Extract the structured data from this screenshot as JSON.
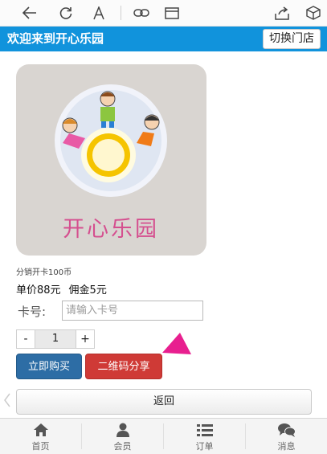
{
  "browser": {
    "back_icon": "arrow-left-icon",
    "refresh_icon": "refresh-icon",
    "font_icon": "font-size-icon",
    "link_icon": "link-icon",
    "window_icon": "window-icon",
    "share_icon": "share-icon",
    "box_icon": "cube-icon"
  },
  "header": {
    "title": "欢迎来到开心乐园",
    "switch_label": "切换门店"
  },
  "product": {
    "image_icon": "happy-park-logo-icon",
    "logo_text": "开心乐园",
    "sales_label": "分销开卡100币",
    "price": "单价88元",
    "commission": "佣金5元"
  },
  "card": {
    "label": "卡号:",
    "placeholder": "请输入卡号",
    "value": ""
  },
  "quantity": {
    "minus": "-",
    "value": "1",
    "plus": "+"
  },
  "actions": {
    "buy_label": "立即购买",
    "share_label": "二维码分享",
    "back_label": "返回"
  },
  "colors": {
    "header": "#1193dc",
    "buy": "#2d6da5",
    "share": "#cf3a36",
    "pointer": "#e81f8f"
  },
  "tabbar": {
    "items": [
      {
        "label": "首页",
        "icon": "home-icon"
      },
      {
        "label": "会员",
        "icon": "user-icon"
      },
      {
        "label": "订单",
        "icon": "list-icon"
      },
      {
        "label": "消息",
        "icon": "chat-icon"
      }
    ]
  }
}
